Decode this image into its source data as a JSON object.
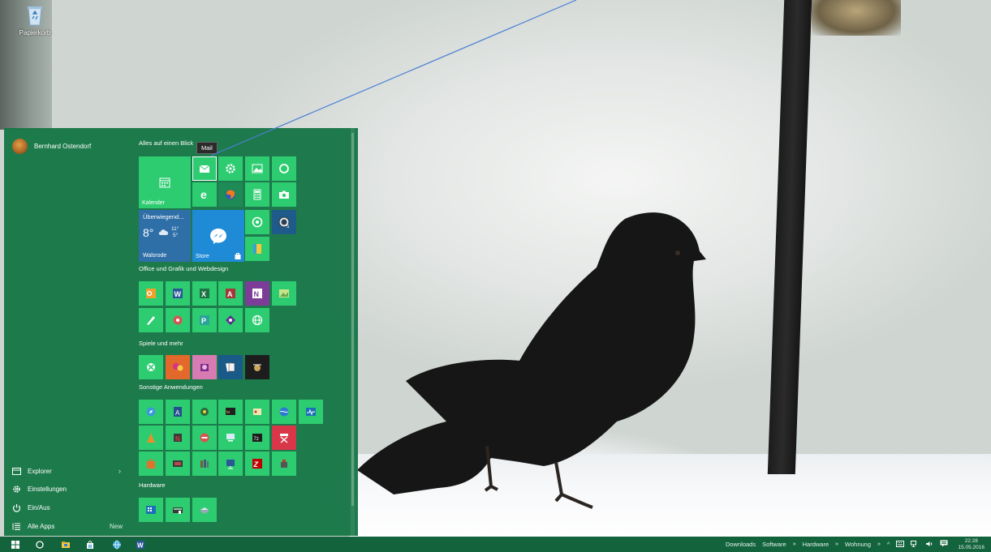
{
  "desktop": {
    "recycle_bin_label": "Papierkorb"
  },
  "start_menu": {
    "user_name": "Bernhard Ostendorf",
    "left_items": [
      {
        "label": "Explorer",
        "icon": "folder-icon"
      },
      {
        "label": "Einstellungen",
        "icon": "gear-icon"
      },
      {
        "label": "Ein/Aus",
        "icon": "power-icon"
      },
      {
        "label": "Alle Apps",
        "icon": "list-icon"
      }
    ],
    "all_apps_badge": "New",
    "groups": [
      {
        "title": "Alles auf einen Blick"
      },
      {
        "title": "Office und Grafik und Webdesign"
      },
      {
        "title": "Spiele und mehr"
      },
      {
        "title": "Sonstige Anwendungen"
      },
      {
        "title": "Hardware"
      }
    ],
    "tiles": {
      "kalender": "Kalender",
      "store": "Store",
      "weather_condition": "Überwiegend...",
      "weather_temp": "8°",
      "weather_high": "11°",
      "weather_low": "5°",
      "weather_city": "Walsrode"
    },
    "tooltip": "Mail"
  },
  "taskbar": {
    "toolbars": [
      "Downloads",
      "Software",
      "Hardware",
      "Wohnung"
    ],
    "time": "22:28",
    "date": "15.05.2016"
  },
  "colors": {
    "start_bg": "#167646",
    "tile": "#2ecc71",
    "taskbar": "#13633d"
  }
}
